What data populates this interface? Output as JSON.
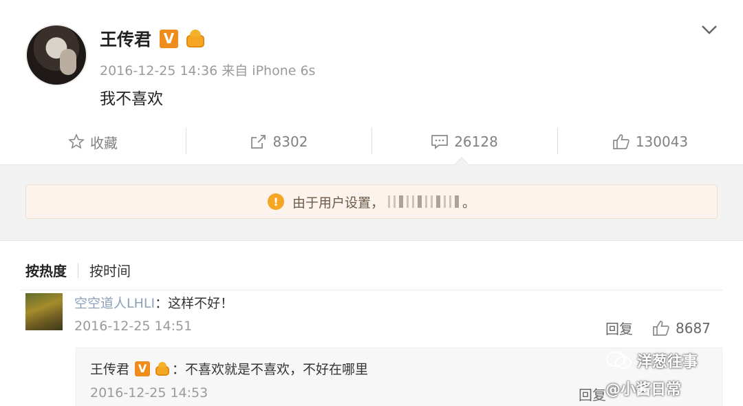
{
  "post": {
    "author": "王传君",
    "badge_v": "V",
    "timestamp": "2016-12-25 14:36 来自 iPhone 6s",
    "text": "我不喜欢"
  },
  "actions": {
    "favorite_label": "收藏",
    "repost_count": "8302",
    "comment_count": "26128",
    "like_count": "130043"
  },
  "notice": {
    "text": "由于用户设置，",
    "end": "。",
    "icon": "!"
  },
  "comments": {
    "sort_hot": "按热度",
    "sort_time": "按时间",
    "items": [
      {
        "user": "空空道人LHLI",
        "text": "：这样不好！",
        "time": "2016-12-25 14:51",
        "reply_label": "回复",
        "likes": "8687",
        "reply": {
          "user": "王传君",
          "badge_v": "V",
          "text": "：不喜欢就是不喜欢，不好在哪里",
          "time": "2016-12-25 14:53",
          "reply_label": "回复"
        }
      }
    ]
  },
  "watermark": {
    "line1": "洋葱往事",
    "line2": "@小酱日常"
  },
  "colors": {
    "verified_badge": "#f08c1b",
    "username_link": "#8da0b8",
    "notice_bg": "#fcf4ec",
    "warning_icon": "#f5a623"
  }
}
